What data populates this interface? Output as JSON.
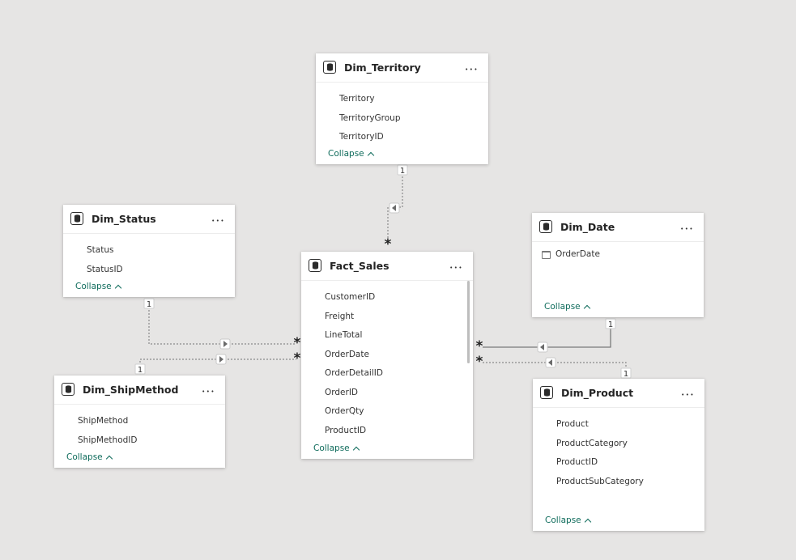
{
  "canvas": {
    "background": "#e6e5e4",
    "link_color": "#8a8a8a",
    "link_color_active": "#7a7a7a"
  },
  "tables": [
    {
      "key": "territory",
      "name": "Dim_Territory",
      "fields": [
        {
          "label": "Territory"
        },
        {
          "label": "TerritoryGroup"
        },
        {
          "label": "TerritoryID"
        }
      ],
      "collapse_label": "Collapse"
    },
    {
      "key": "status",
      "name": "Dim_Status",
      "fields": [
        {
          "label": "Status"
        },
        {
          "label": "StatusID"
        }
      ],
      "collapse_label": "Collapse"
    },
    {
      "key": "date",
      "name": "Dim_Date",
      "fields": [
        {
          "label": "OrderDate",
          "icon": "calendar-icon"
        }
      ],
      "collapse_label": "Collapse"
    },
    {
      "key": "sales",
      "name": "Fact_Sales",
      "fields": [
        {
          "label": "CustomerID"
        },
        {
          "label": "Freight"
        },
        {
          "label": "LineTotal"
        },
        {
          "label": "OrderDate"
        },
        {
          "label": "OrderDetailID"
        },
        {
          "label": "OrderID"
        },
        {
          "label": "OrderQty"
        },
        {
          "label": "ProductID"
        }
      ],
      "collapse_label": "Collapse"
    },
    {
      "key": "shipmethod",
      "name": "Dim_ShipMethod",
      "fields": [
        {
          "label": "ShipMethod"
        },
        {
          "label": "ShipMethodID"
        }
      ],
      "collapse_label": "Collapse"
    },
    {
      "key": "product",
      "name": "Dim_Product",
      "fields": [
        {
          "label": "Product"
        },
        {
          "label": "ProductCategory"
        },
        {
          "label": "ProductID"
        },
        {
          "label": "ProductSubCategory"
        }
      ],
      "collapse_label": "Collapse"
    }
  ],
  "relationships": [
    {
      "from": "Dim_Territory",
      "to": "Fact_Sales",
      "from_cardinality": "1",
      "to_cardinality": "*",
      "style": "dashed"
    },
    {
      "from": "Dim_Status",
      "to": "Fact_Sales",
      "from_cardinality": "1",
      "to_cardinality": "*",
      "style": "dashed"
    },
    {
      "from": "Dim_ShipMethod",
      "to": "Fact_Sales",
      "from_cardinality": "1",
      "to_cardinality": "*",
      "style": "dashed"
    },
    {
      "from": "Dim_Date",
      "to": "Fact_Sales",
      "from_cardinality": "1",
      "to_cardinality": "*",
      "style": "solid"
    },
    {
      "from": "Dim_Product",
      "to": "Fact_Sales",
      "from_cardinality": "1",
      "to_cardinality": "*",
      "style": "dashed"
    }
  ]
}
